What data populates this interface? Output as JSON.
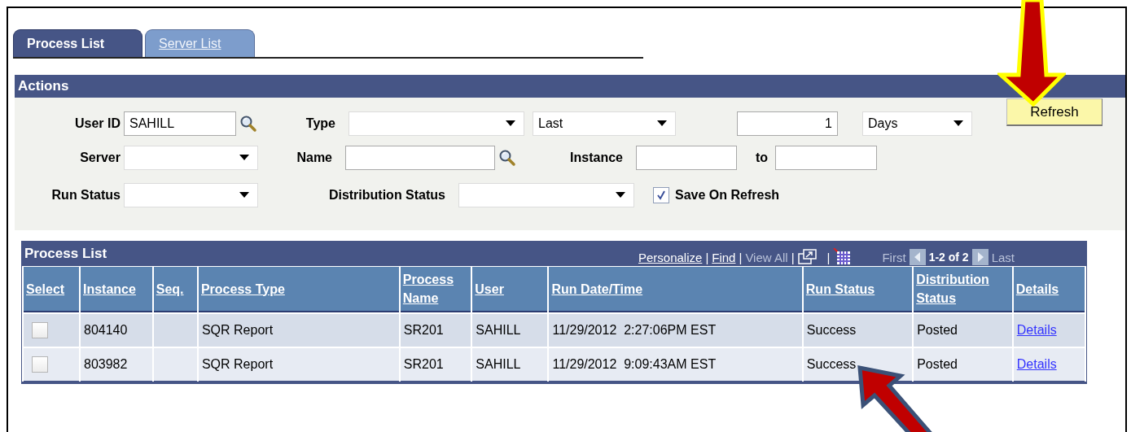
{
  "tabs": [
    {
      "label": "Process List",
      "selected": true
    },
    {
      "label": "Server List",
      "selected": false
    }
  ],
  "actions": {
    "title": "Actions",
    "user_id": {
      "label": "User ID",
      "value": "SAHILL"
    },
    "type": {
      "label": "Type"
    },
    "period": {
      "value": "Last"
    },
    "count": {
      "value": "1"
    },
    "unit": {
      "value": "Days"
    },
    "refresh_button": "Refresh",
    "server": {
      "label": "Server"
    },
    "name": {
      "label": "Name"
    },
    "instance": {
      "label": "Instance"
    },
    "instance_to": {
      "label": "to"
    },
    "run_status": {
      "label": "Run Status"
    },
    "distribution_status": {
      "label": "Distribution Status"
    },
    "save_on_refresh": {
      "label": "Save On Refresh",
      "checked": true
    }
  },
  "process_list": {
    "title": "Process List",
    "toolbar": [
      {
        "kind": "link",
        "label": "Personalize",
        "disabled": false
      },
      {
        "kind": "separator",
        "label": "|"
      },
      {
        "kind": "link",
        "label": "Find",
        "disabled": false
      },
      {
        "kind": "separator",
        "label": "|"
      },
      {
        "kind": "link",
        "label": "View All",
        "disabled": true
      },
      {
        "kind": "separator",
        "label": "|"
      },
      {
        "kind": "window_icon"
      },
      {
        "kind": "separator",
        "label": "|"
      },
      {
        "kind": "grid_icon"
      }
    ],
    "first": "First",
    "range": "1-2 of 2",
    "last": "Last",
    "columns": [
      "Select",
      "Instance",
      "Seq.",
      "Process Type",
      "Process Name",
      "User",
      "Run Date/Time",
      "Run Status",
      "Distribution Status",
      "Details"
    ],
    "rows": [
      {
        "checked": false,
        "instance": "804140",
        "process_type": "SQR Report",
        "process_name": "SR201",
        "user": "SAHILL",
        "run_date_time": "11/29/2012  2:27:06PM EST",
        "run_status": "Success",
        "distribution_status": "Posted",
        "details": "Details"
      },
      {
        "checked": false,
        "instance": "803982",
        "process_type": "SQR Report",
        "process_name": "SR201",
        "user": "SAHILL",
        "run_date_time": "11/29/2012  9:09:43AM EST",
        "run_status": "Success",
        "distribution_status": "Posted",
        "details": "Details"
      }
    ]
  }
}
